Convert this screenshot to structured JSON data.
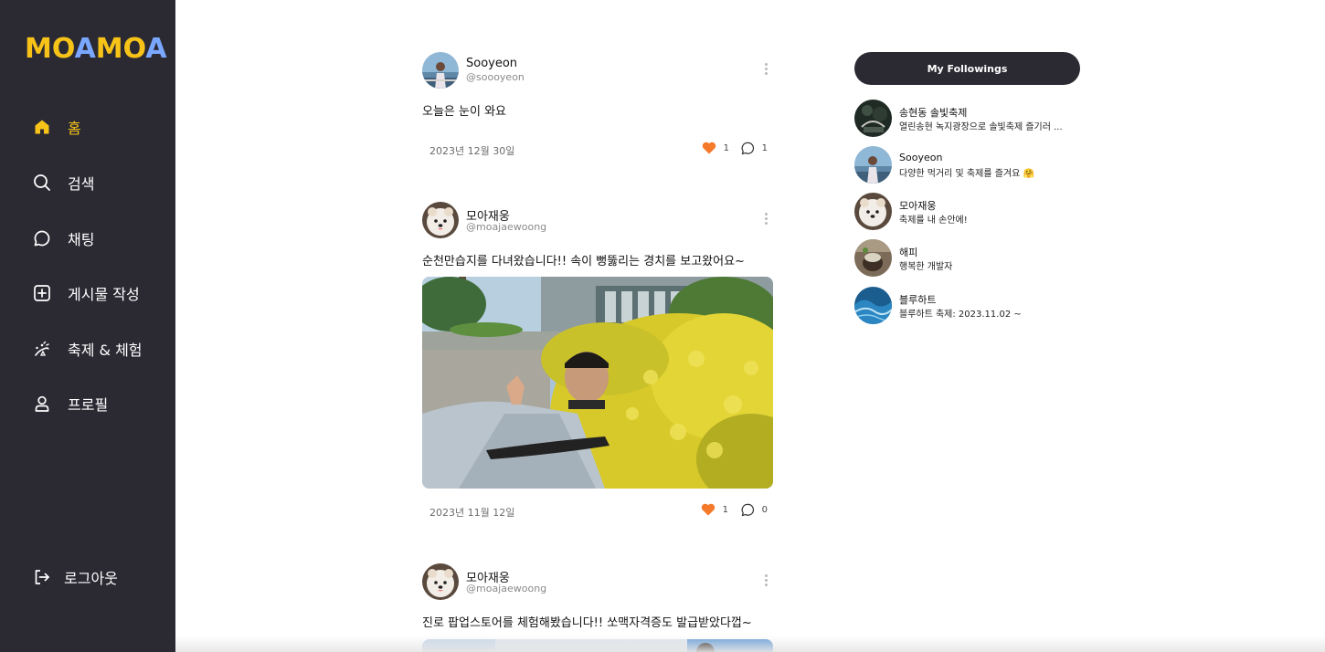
{
  "logo": {
    "part1": "MO",
    "part2": "A",
    "part3": "MO",
    "part4": "A"
  },
  "colors": {
    "sidebar_bg": "#2b2a33",
    "accent_yellow": "#f7c318",
    "logo_blue": "#7aa7ff",
    "like_orange": "#f47a2a"
  },
  "nav": {
    "home": {
      "label": "홈",
      "icon": "home-icon"
    },
    "search": {
      "label": "검색",
      "icon": "search-icon"
    },
    "chat": {
      "label": "채팅",
      "icon": "chat-icon"
    },
    "write": {
      "label": "게시물 작성",
      "icon": "plus-square-icon"
    },
    "festival": {
      "label": "축제 & 체험",
      "icon": "festival-icon"
    },
    "profile": {
      "label": "프로필",
      "icon": "user-icon"
    },
    "logout": {
      "label": "로그아웃",
      "icon": "logout-icon"
    }
  },
  "posts": [
    {
      "name": "Sooyeon",
      "handle": "@soooyeon",
      "text": "오늘은 눈이 와요",
      "date": "2023년 12월 30일",
      "likes": "1",
      "comments": "1",
      "has_image": false
    },
    {
      "name": "모아재웅",
      "handle": "@moajaewoong",
      "text": "순천만습지를 다녀왔습니다!! 속이 뻥뚫리는 경치를 보고왔어요~",
      "date": "2023년 11월 12일",
      "likes": "1",
      "comments": "0",
      "has_image": true
    },
    {
      "name": "모아재웅",
      "handle": "@moajaewoong",
      "text": "진로 팝업스토어를 체험해봤습니다!! 쏘맥자격증도 발급받았다껍~",
      "has_image": true
    }
  ],
  "followings": {
    "button_label": "My Followings",
    "items": [
      {
        "name": "송현동 솔빛축제",
        "desc": "열린송현 녹지광장으로 솔빛축제 즐기러 ..."
      },
      {
        "name": "Sooyeon",
        "desc": "다양한 먹거리 및 축제를 즐겨요 🤗"
      },
      {
        "name": "모아재웅",
        "desc": "축제를 내 손안에!"
      },
      {
        "name": "해피",
        "desc": "행복한 개발자"
      },
      {
        "name": "블루하트",
        "desc": "블루하트 축제: 2023.11.02 ~"
      }
    ]
  }
}
